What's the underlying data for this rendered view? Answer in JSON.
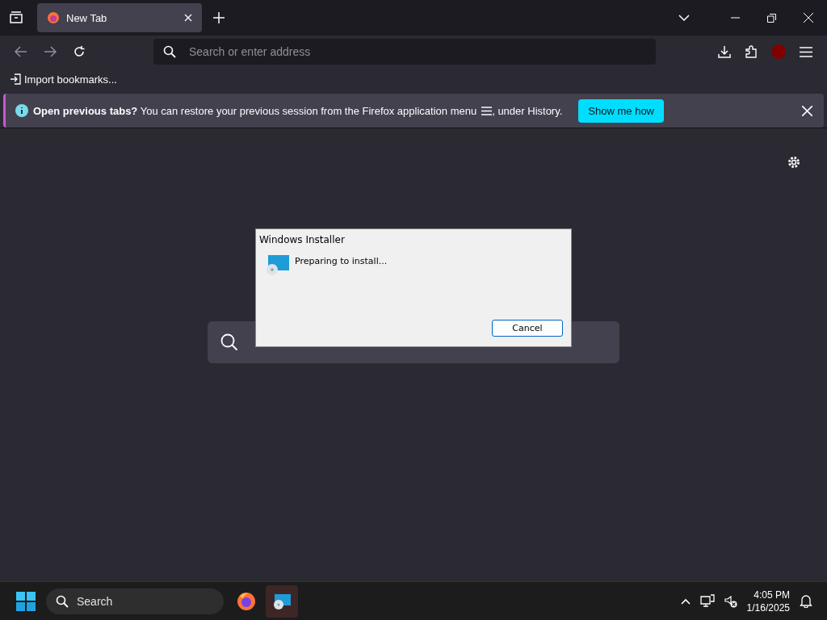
{
  "tabs": [
    {
      "title": "New Tab",
      "selected": true
    }
  ],
  "address_bar": {
    "placeholder": "Search or enter address"
  },
  "bookmarks_toolbar": {
    "items": [
      "Import bookmarks..."
    ]
  },
  "notification": {
    "message": "**Open previous tabs?** You can restore your previous session from the Firefox application menu",
    "message_end": ", under History.",
    "button": "Show me how"
  },
  "dialog": {
    "title": "Windows Installer",
    "message": "Preparing to install...",
    "button": "Cancel"
  },
  "taskbar": {
    "search_label": "Search",
    "apps": [
      {
        "kind": "firefox",
        "selected": false
      },
      {
        "kind": "installer",
        "selected": true
      }
    ],
    "time": "4:05 PM",
    "date": "1/16/2025"
  }
}
